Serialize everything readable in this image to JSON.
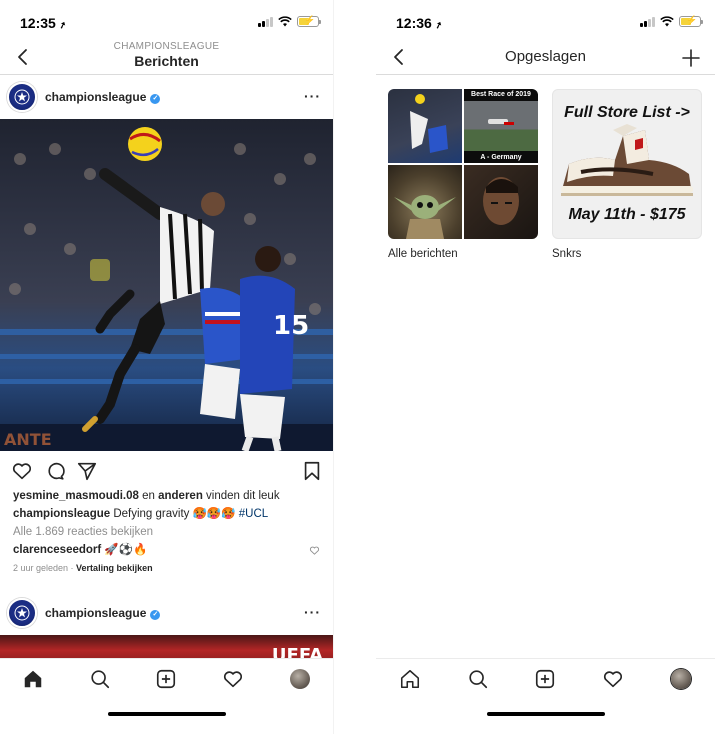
{
  "left": {
    "status": {
      "time": "12:35",
      "location_arrow": "➚"
    },
    "header": {
      "subtitle": "CHAMPIONSLEAGUE",
      "title": "Berichten"
    },
    "post1": {
      "username": "championsleague",
      "verified": "✓",
      "more": "···",
      "likes": {
        "user": "yesmine_masmoudi.08",
        "middle": " en ",
        "others": "anderen",
        "suffix": " vinden dit leuk"
      },
      "caption": {
        "user": "championsleague",
        "text": " Defying gravity 🥵🥵🥵 ",
        "hashtag": "#UCL"
      },
      "view_comments": "Alle 1.869 reacties bekijken",
      "comment": {
        "user": "clarenceseedorf",
        "text": " 🚀⚽🔥"
      },
      "time": "2 uur geleden",
      "separator": " · ",
      "translate": "Vertaling bekijken"
    },
    "post2": {
      "username": "championsleague",
      "verified": "✓",
      "more": "···",
      "photo_text": "UEFA"
    },
    "tabs": [
      "home-icon",
      "search-icon",
      "add-post-icon",
      "activity-icon",
      "profile-avatar"
    ]
  },
  "right": {
    "status": {
      "time": "12:36",
      "location_arrow": "➚"
    },
    "header": {
      "title": "Opgeslagen"
    },
    "collections": [
      {
        "label": "Alle berichten",
        "tile_texts": {
          "best_race": "Best Race of 2019",
          "germany": "A - Germany"
        }
      },
      {
        "label": "Snkrs",
        "cover_top": "Full Store List ->",
        "cover_bottom": "May 11th - $175"
      }
    ],
    "tabs": [
      "home-icon",
      "search-icon",
      "add-post-icon",
      "activity-icon",
      "profile-avatar"
    ]
  },
  "colors": {
    "accent_blue": "#3897f0",
    "hashtag": "#003569",
    "muted": "#8e8e8e",
    "battery": "#f5d33a"
  }
}
